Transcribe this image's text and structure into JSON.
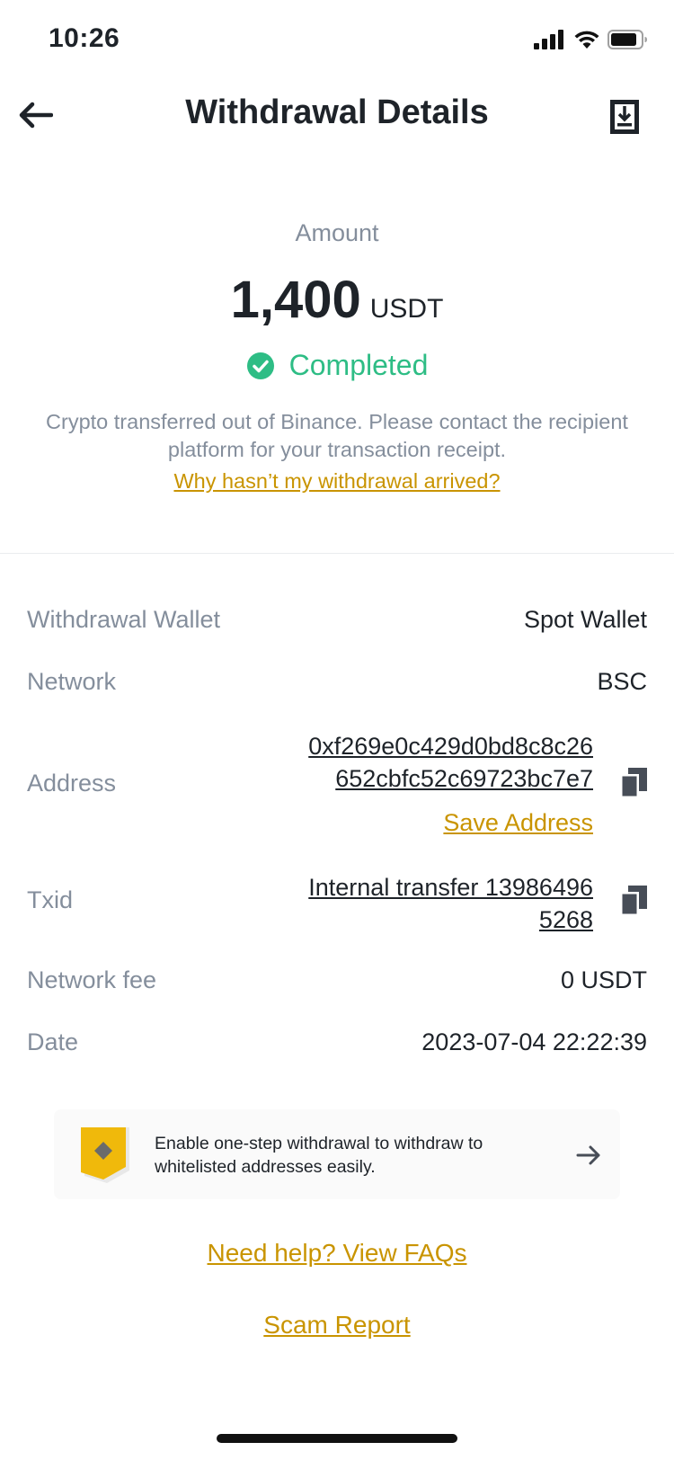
{
  "status_bar": {
    "time": "10:26"
  },
  "header": {
    "title": "Withdrawal Details"
  },
  "amount": {
    "label": "Amount",
    "value": "1,400",
    "unit": "USDT",
    "status": "Completed",
    "notice": "Crypto transferred out of Binance. Please contact the recipient platform for your transaction receipt.",
    "help_link": "Why hasn’t my withdrawal arrived?"
  },
  "details": {
    "wallet": {
      "label": "Withdrawal Wallet",
      "value": "Spot Wallet"
    },
    "network": {
      "label": "Network",
      "value": "BSC"
    },
    "address": {
      "label": "Address",
      "line1": "0xf269e0c429d0bd8c8c26",
      "line2": "652cbfc52c69723bc7e7",
      "save_label": "Save Address"
    },
    "txid": {
      "label": "Txid",
      "line1": "Internal transfer 13986496",
      "line2": "5268"
    },
    "fee": {
      "label": "Network fee",
      "value": "0 USDT"
    },
    "date": {
      "label": "Date",
      "value": "2023-07-04 22:22:39"
    }
  },
  "banner": {
    "text": "Enable one-step withdrawal to withdraw to whitelisted addresses easily."
  },
  "links": {
    "faq": "Need help? View FAQs",
    "scam": "Scam Report"
  },
  "colors": {
    "accent": "#c99400",
    "success": "#2ebd85",
    "muted": "#848e9c",
    "text": "#1e2329"
  }
}
